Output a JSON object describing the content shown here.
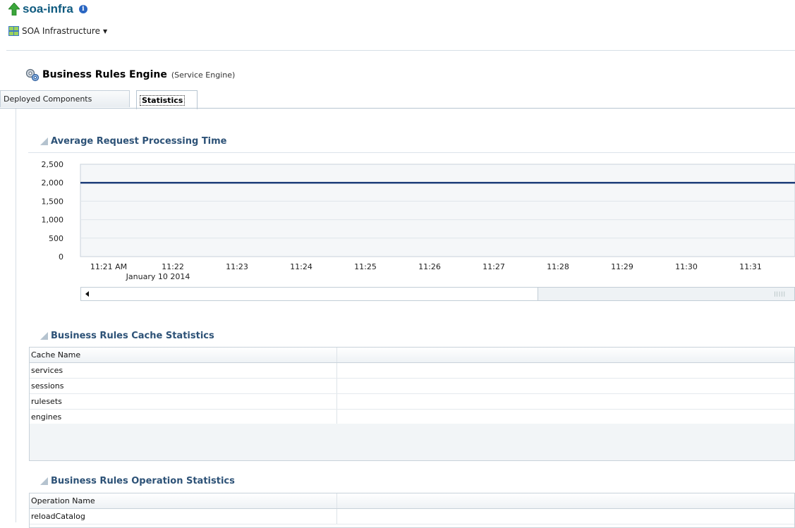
{
  "header": {
    "title": "soa-infra",
    "info_icon": "info-icon",
    "target_menu": "SOA Infrastructure"
  },
  "engine": {
    "title": "Business Rules Engine",
    "subtitle": "(Service Engine)"
  },
  "tabs": [
    {
      "label": "Deployed Components",
      "selected": false
    },
    {
      "label": "Statistics",
      "selected": true
    }
  ],
  "panels": {
    "chart_title": "Average Request Processing Time",
    "cache_title": "Business Rules Cache Statistics",
    "operation_title": "Business Rules Operation Statistics"
  },
  "chart_data": {
    "type": "line",
    "title": "Average Request Processing Time",
    "y_ticks": [
      "2,500",
      "2,000",
      "1,500",
      "1,000",
      "500",
      "0"
    ],
    "ylim": [
      0,
      2500
    ],
    "x_ticks": [
      "11:21 AM",
      "11:22",
      "11:23",
      "11:24",
      "11:25",
      "11:26",
      "11:27",
      "11:28",
      "11:29",
      "11:30",
      "11:31"
    ],
    "x_date": "January 10 2014",
    "series": [
      {
        "color": "#1f3f7a",
        "x": [
          "11:21 AM",
          "11:31"
        ],
        "values": [
          2000,
          2000
        ]
      }
    ],
    "grid": true
  },
  "cache_table": {
    "header": "Cache Name",
    "rows": [
      "services",
      "sessions",
      "rulesets",
      "engines"
    ]
  },
  "operation_table": {
    "header": "Operation Name",
    "rows": [
      "reloadCatalog"
    ]
  },
  "colors": {
    "title_blue": "#0e5a7f",
    "panel_header": "#2d5277",
    "series_line": "#1f3f7a"
  }
}
